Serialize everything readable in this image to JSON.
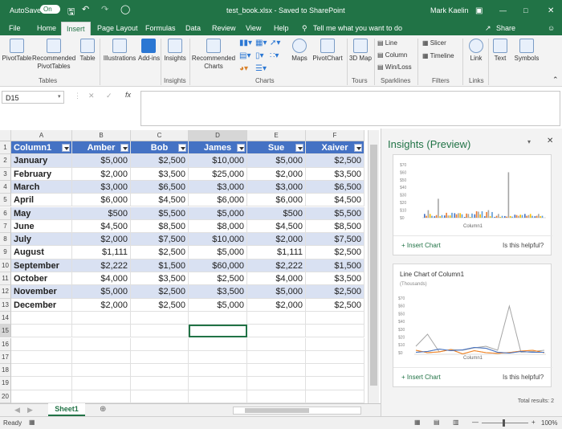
{
  "titlebar": {
    "autosave_label": "AutoSave",
    "autosave_state": "On",
    "title": "test_book.xlsx  -  Saved to SharePoint",
    "user": "Mark Kaelin"
  },
  "tabs": [
    "File",
    "Home",
    "Insert",
    "Page Layout",
    "Formulas",
    "Data",
    "Review",
    "View",
    "Help"
  ],
  "active_tab": "Insert",
  "tell_me": "Tell me what you want to do",
  "share": "Share",
  "ribbon": {
    "tables": {
      "items": [
        "PivotTable",
        "Recommended PivotTables",
        "Table"
      ],
      "label": "Tables"
    },
    "illustrations": "Illustrations",
    "addins": "Add-ins",
    "insights": {
      "item": "Insights",
      "label": "Insights"
    },
    "charts": {
      "recommended": "Recommended Charts",
      "maps": "Maps",
      "pivotchart": "PivotChart",
      "label": "Charts"
    },
    "tours": {
      "item": "3D Map",
      "label": "Tours"
    },
    "sparklines": {
      "items": [
        "Line",
        "Column",
        "Win/Loss"
      ],
      "label": "Sparklines"
    },
    "filters": {
      "items": [
        "Slicer",
        "Timeline"
      ],
      "label": "Filters"
    },
    "links": {
      "item": "Link",
      "label": "Links"
    },
    "text": "Text",
    "symbols": "Symbols"
  },
  "namebox": "D15",
  "fx_label": "fx",
  "columns": [
    "A",
    "B",
    "C",
    "D",
    "E",
    "F"
  ],
  "table": {
    "headers": [
      "Column1",
      "Amber",
      "Bob",
      "James",
      "Sue",
      "Xaiver"
    ],
    "rows": [
      [
        "January",
        "$5,000",
        "$2,500",
        "$10,000",
        "$5,000",
        "$2,500"
      ],
      [
        "February",
        "$2,000",
        "$3,500",
        "$25,000",
        "$2,000",
        "$3,500"
      ],
      [
        "March",
        "$3,000",
        "$6,500",
        "$3,000",
        "$3,000",
        "$6,500"
      ],
      [
        "April",
        "$6,000",
        "$4,500",
        "$6,000",
        "$6,000",
        "$4,500"
      ],
      [
        "May",
        "$500",
        "$5,500",
        "$5,000",
        "$500",
        "$5,500"
      ],
      [
        "June",
        "$4,500",
        "$8,500",
        "$8,000",
        "$4,500",
        "$8,500"
      ],
      [
        "July",
        "$2,000",
        "$7,500",
        "$10,000",
        "$2,000",
        "$7,500"
      ],
      [
        "August",
        "$1,111",
        "$2,500",
        "$5,000",
        "$1,111",
        "$2,500"
      ],
      [
        "September",
        "$2,222",
        "$1,500",
        "$60,000",
        "$2,222",
        "$1,500"
      ],
      [
        "October",
        "$4,000",
        "$3,500",
        "$2,500",
        "$4,000",
        "$3,500"
      ],
      [
        "November",
        "$5,000",
        "$2,500",
        "$3,500",
        "$5,000",
        "$2,500"
      ],
      [
        "December",
        "$2,000",
        "$2,500",
        "$5,000",
        "$2,000",
        "$2,500"
      ]
    ]
  },
  "row_numbers": [
    "1",
    "2",
    "3",
    "4",
    "5",
    "6",
    "7",
    "8",
    "9",
    "10",
    "11",
    "12",
    "13",
    "14",
    "15",
    "16",
    "17",
    "18",
    "19",
    "20"
  ],
  "insights": {
    "title": "Insights (Preview)",
    "card1": {
      "yticks": [
        "$70",
        "$60",
        "$50",
        "$40",
        "$30",
        "$20",
        "$10",
        "$0"
      ],
      "xlabel": "Column1",
      "insert": "Insert Chart",
      "helpful": "Is this helpful?"
    },
    "card2": {
      "title": "Line Chart of Column1",
      "subtitle": "(Thousands)",
      "yticks": [
        "$70",
        "$60",
        "$50",
        "$40",
        "$30",
        "$20",
        "$10",
        "$0"
      ],
      "xlabel": "Column1",
      "insert": "Insert Chart",
      "helpful": "Is this helpful?"
    },
    "total": "Total results: 2"
  },
  "sheet_tab": "Sheet1",
  "status": {
    "ready": "Ready",
    "zoom": "100%"
  },
  "colors": {
    "excel_green": "#217346",
    "table_header": "#4472c4",
    "band": "#d9e1f2"
  }
}
